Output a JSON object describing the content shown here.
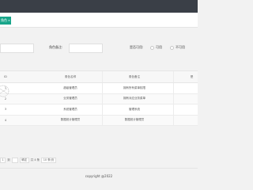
{
  "tab": {
    "label": "角色",
    "close": "✕"
  },
  "search": {
    "name_label": "",
    "remark_label": "角色备注:",
    "status_label": "是否可用:",
    "status_options": [
      "可用",
      "不可用"
    ]
  },
  "table": {
    "columns": [
      "ID",
      "角色名称",
      "角色备注",
      "是"
    ],
    "rows": [
      {
        "id": "1",
        "name": "超级管理员",
        "remark": "拥有所有菜单权限"
      },
      {
        "id": "2",
        "name": "业务管理员",
        "remark": "拥有对应业务菜单"
      },
      {
        "id": "3",
        "name": "系统管理员",
        "remark": "管理系统"
      },
      {
        "id": "4",
        "name": "数据统计管理员",
        "remark": "数据统计管理员"
      }
    ]
  },
  "pager": {
    "page": "1",
    "goto": "到",
    "confirm": "确定",
    "total": "共 4 条",
    "per_page": "10 条/页"
  },
  "footer": "copyright @2022",
  "colors": {
    "accent": "#18a58a",
    "topbar": "#3a3f47"
  }
}
